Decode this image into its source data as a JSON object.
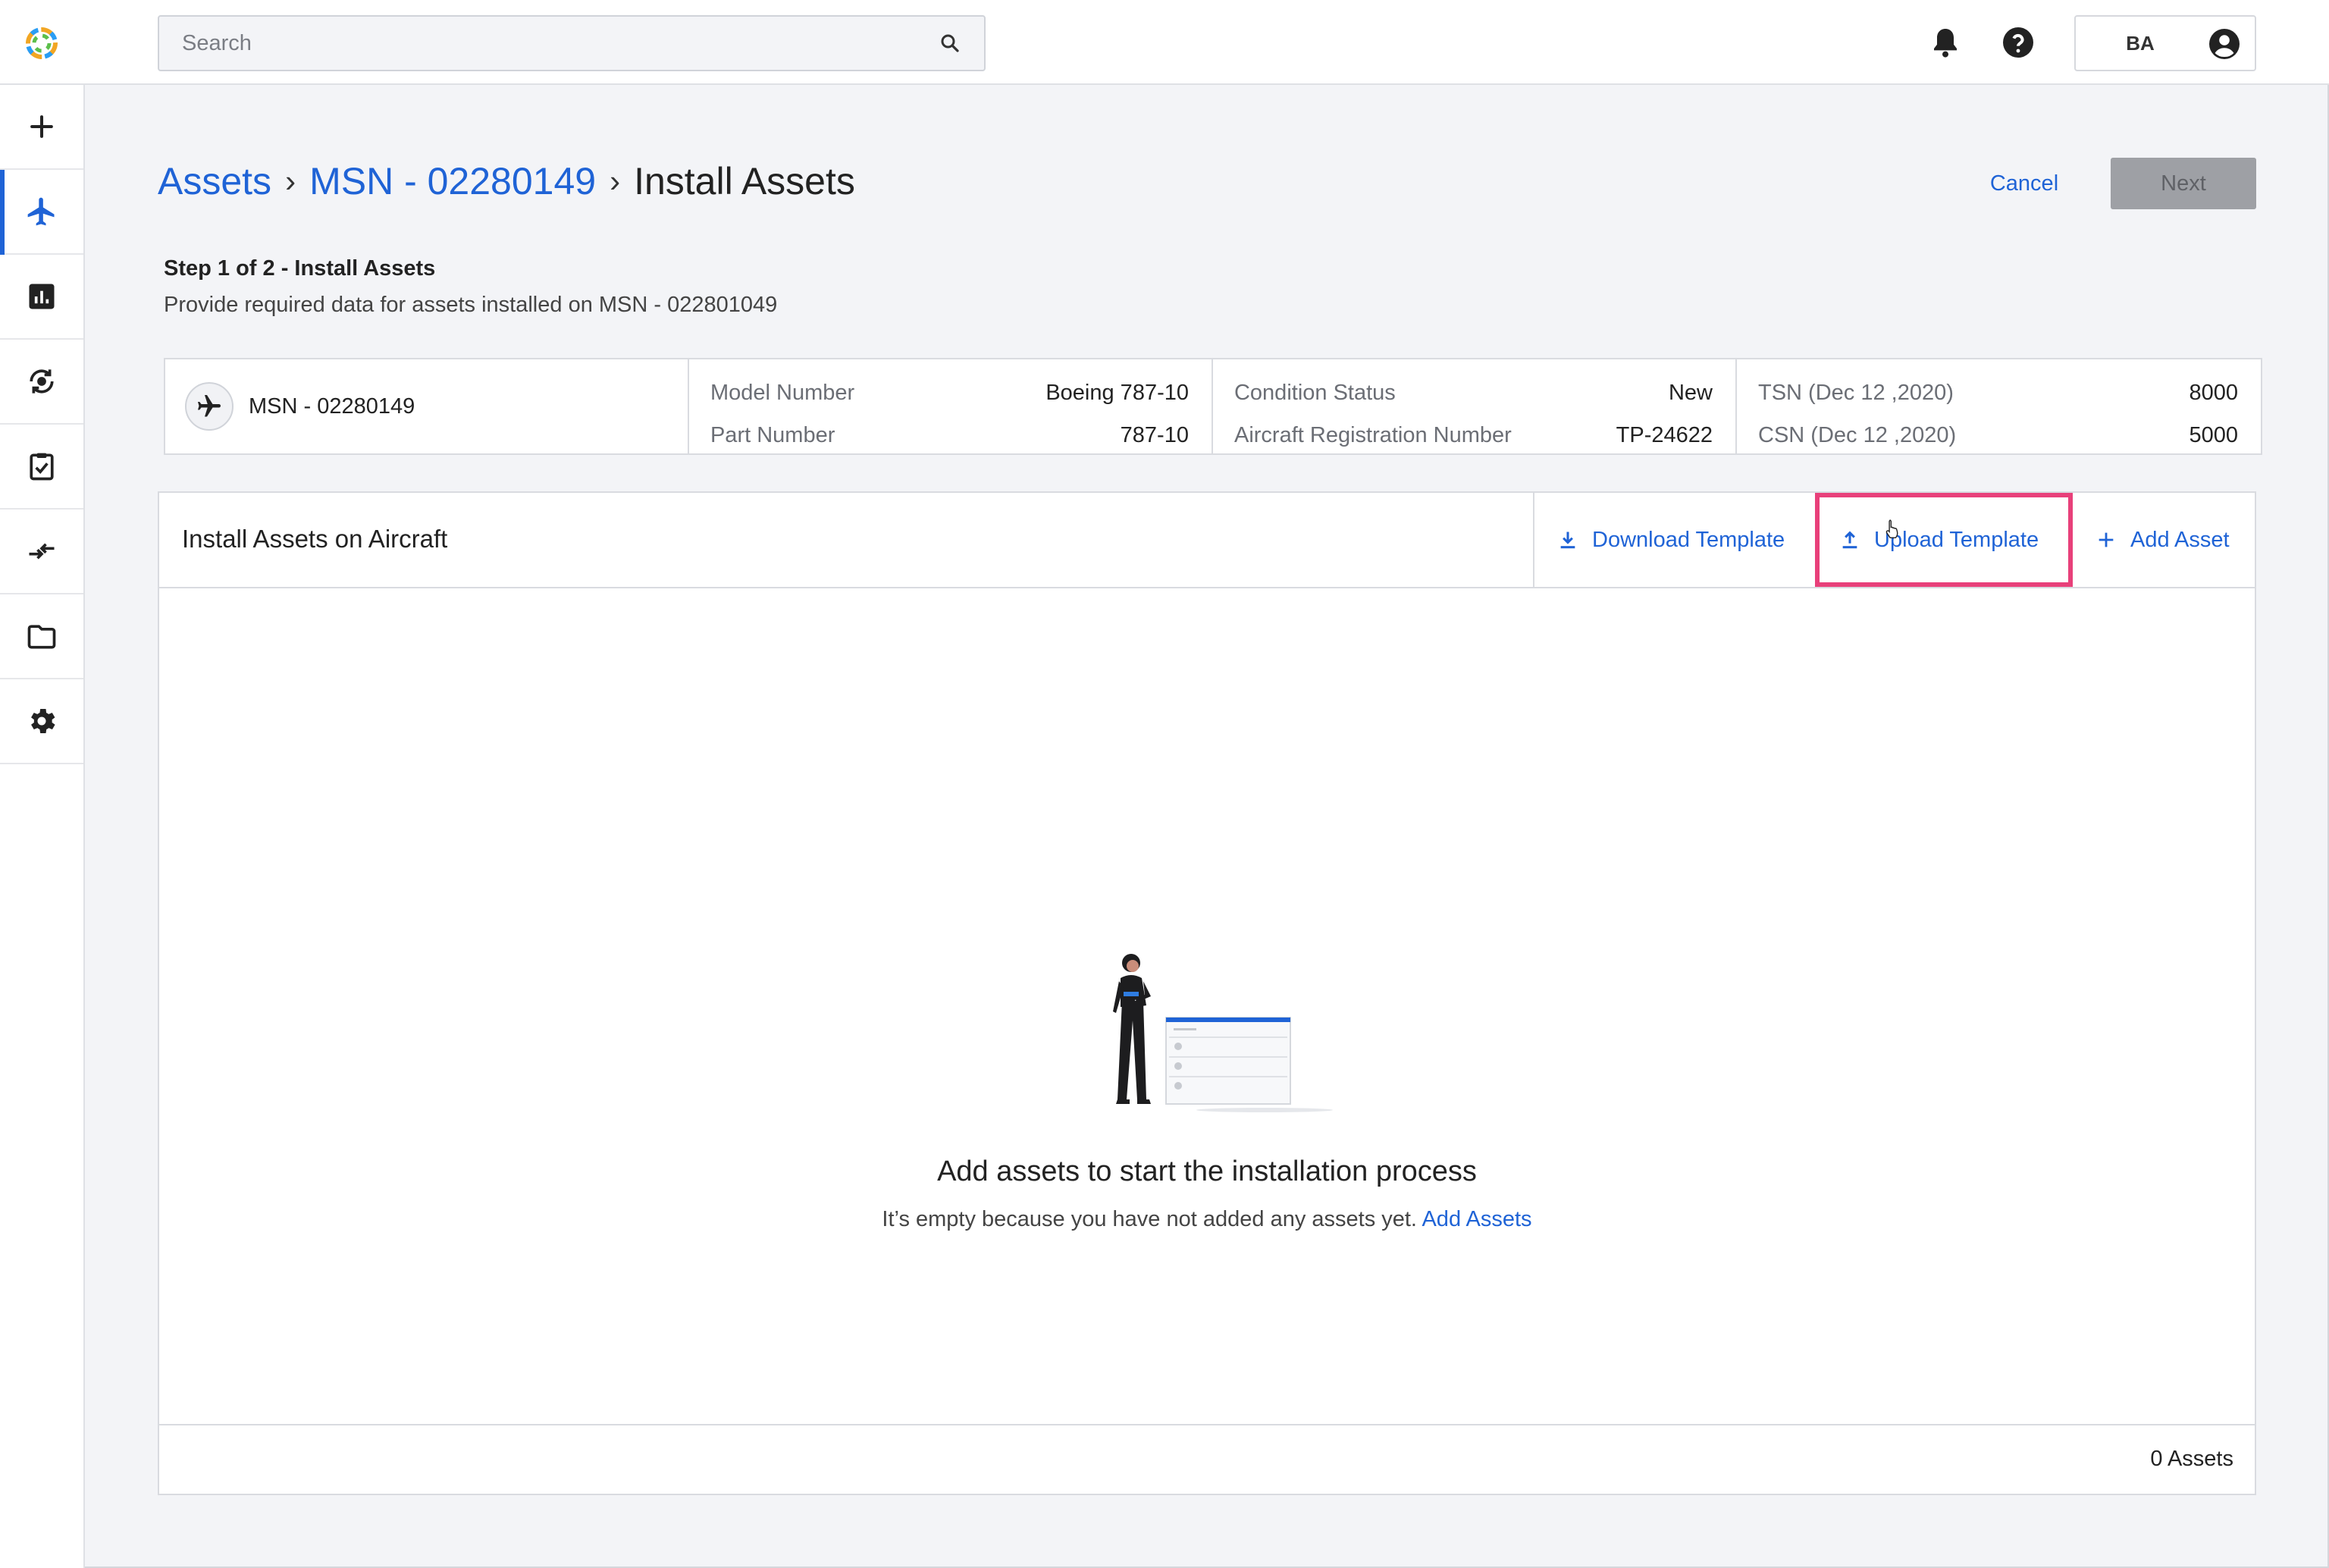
{
  "header": {
    "search_placeholder": "Search",
    "user_initials": "BA",
    "icons": [
      "logo-icon",
      "search-icon",
      "bell-icon",
      "help-icon",
      "account-icon"
    ]
  },
  "sidebar": {
    "items": [
      {
        "name": "add",
        "icon": "plus-icon",
        "active": false
      },
      {
        "name": "aircraft",
        "icon": "airplane-icon",
        "active": true
      },
      {
        "name": "reports",
        "icon": "chart-icon",
        "active": false
      },
      {
        "name": "maintenance",
        "icon": "gear-cycle-icon",
        "active": false
      },
      {
        "name": "tasks",
        "icon": "clipboard-check-icon",
        "active": false
      },
      {
        "name": "transfers",
        "icon": "swap-arrows-icon",
        "active": false
      },
      {
        "name": "documents",
        "icon": "folder-icon",
        "active": false
      },
      {
        "name": "settings",
        "icon": "gear-icon",
        "active": false
      }
    ]
  },
  "breadcrumb": {
    "items": [
      "Assets",
      "MSN - 02280149"
    ],
    "separator": "›",
    "current": "Install Assets"
  },
  "actions": {
    "cancel": "Cancel",
    "next": "Next"
  },
  "step": {
    "title": "Step 1 of 2 - Install Assets",
    "description": "Provide required data for assets installed on MSN - 022801049"
  },
  "aircraft_info": {
    "msn": "MSN - 02280149",
    "model_number_label": "Model Number",
    "model_number": "Boeing 787-10",
    "part_number_label": "Part Number",
    "part_number": "787-10",
    "condition_status_label": "Condition Status",
    "condition_status": "New",
    "registration_label": "Aircraft Registration Number",
    "registration": "TP-24622",
    "tsn_label": "TSN (Dec 12 ,2020)",
    "tsn": "8000",
    "csn_label": "CSN (Dec 12 ,2020)",
    "csn": "5000"
  },
  "panel": {
    "title": "Install Assets on Aircraft",
    "download_template": "Download Template",
    "upload_template": "Upload Template",
    "add_asset": "Add Asset",
    "empty_title": "Add assets to start the installation process",
    "empty_text": "It’s empty because you have not added any assets yet.",
    "empty_link": "Add Assets",
    "asset_count": "0 Assets",
    "highlight_color": "#e8407a"
  },
  "colors": {
    "accent": "#1f63d6",
    "background": "#f3f4f7",
    "disabled_button": "#9ea0a5"
  }
}
